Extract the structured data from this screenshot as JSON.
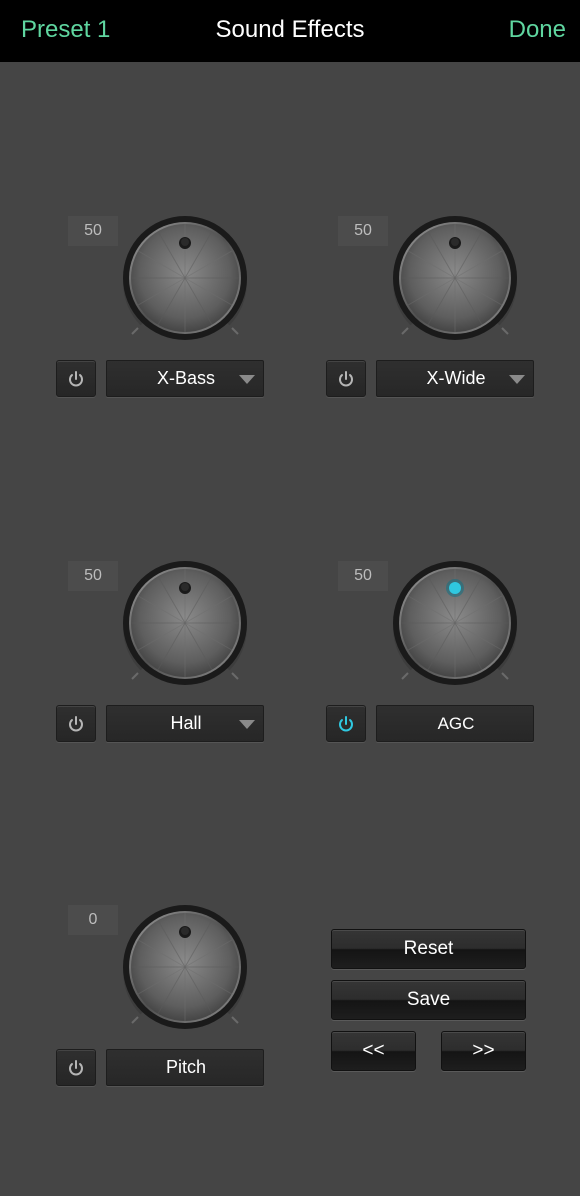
{
  "nav": {
    "left_label": "Preset 1",
    "title": "Sound Effects",
    "right_label": "Done",
    "accent_color": "#5fd6a0"
  },
  "effects": [
    {
      "key": "xbass",
      "value": "50",
      "label": "X-Bass",
      "has_dropdown": true,
      "active": false
    },
    {
      "key": "xwide",
      "value": "50",
      "label": "X-Wide",
      "has_dropdown": true,
      "active": false
    },
    {
      "key": "hall",
      "value": "50",
      "label": "Hall",
      "has_dropdown": true,
      "active": false
    },
    {
      "key": "agc",
      "value": "50",
      "label": "AGC",
      "has_dropdown": false,
      "active": true
    },
    {
      "key": "pitch",
      "value": "0",
      "label": "Pitch",
      "has_dropdown": false,
      "active": false
    }
  ],
  "buttons": {
    "reset": "Reset",
    "save": "Save",
    "prev": "<<",
    "next": ">>"
  },
  "colors": {
    "active_power": "#2fc8e0",
    "inactive_power": "#b5b5b5",
    "background": "#454545"
  },
  "icons": {
    "power": "power-icon",
    "dropdown": "caret-down-icon"
  }
}
